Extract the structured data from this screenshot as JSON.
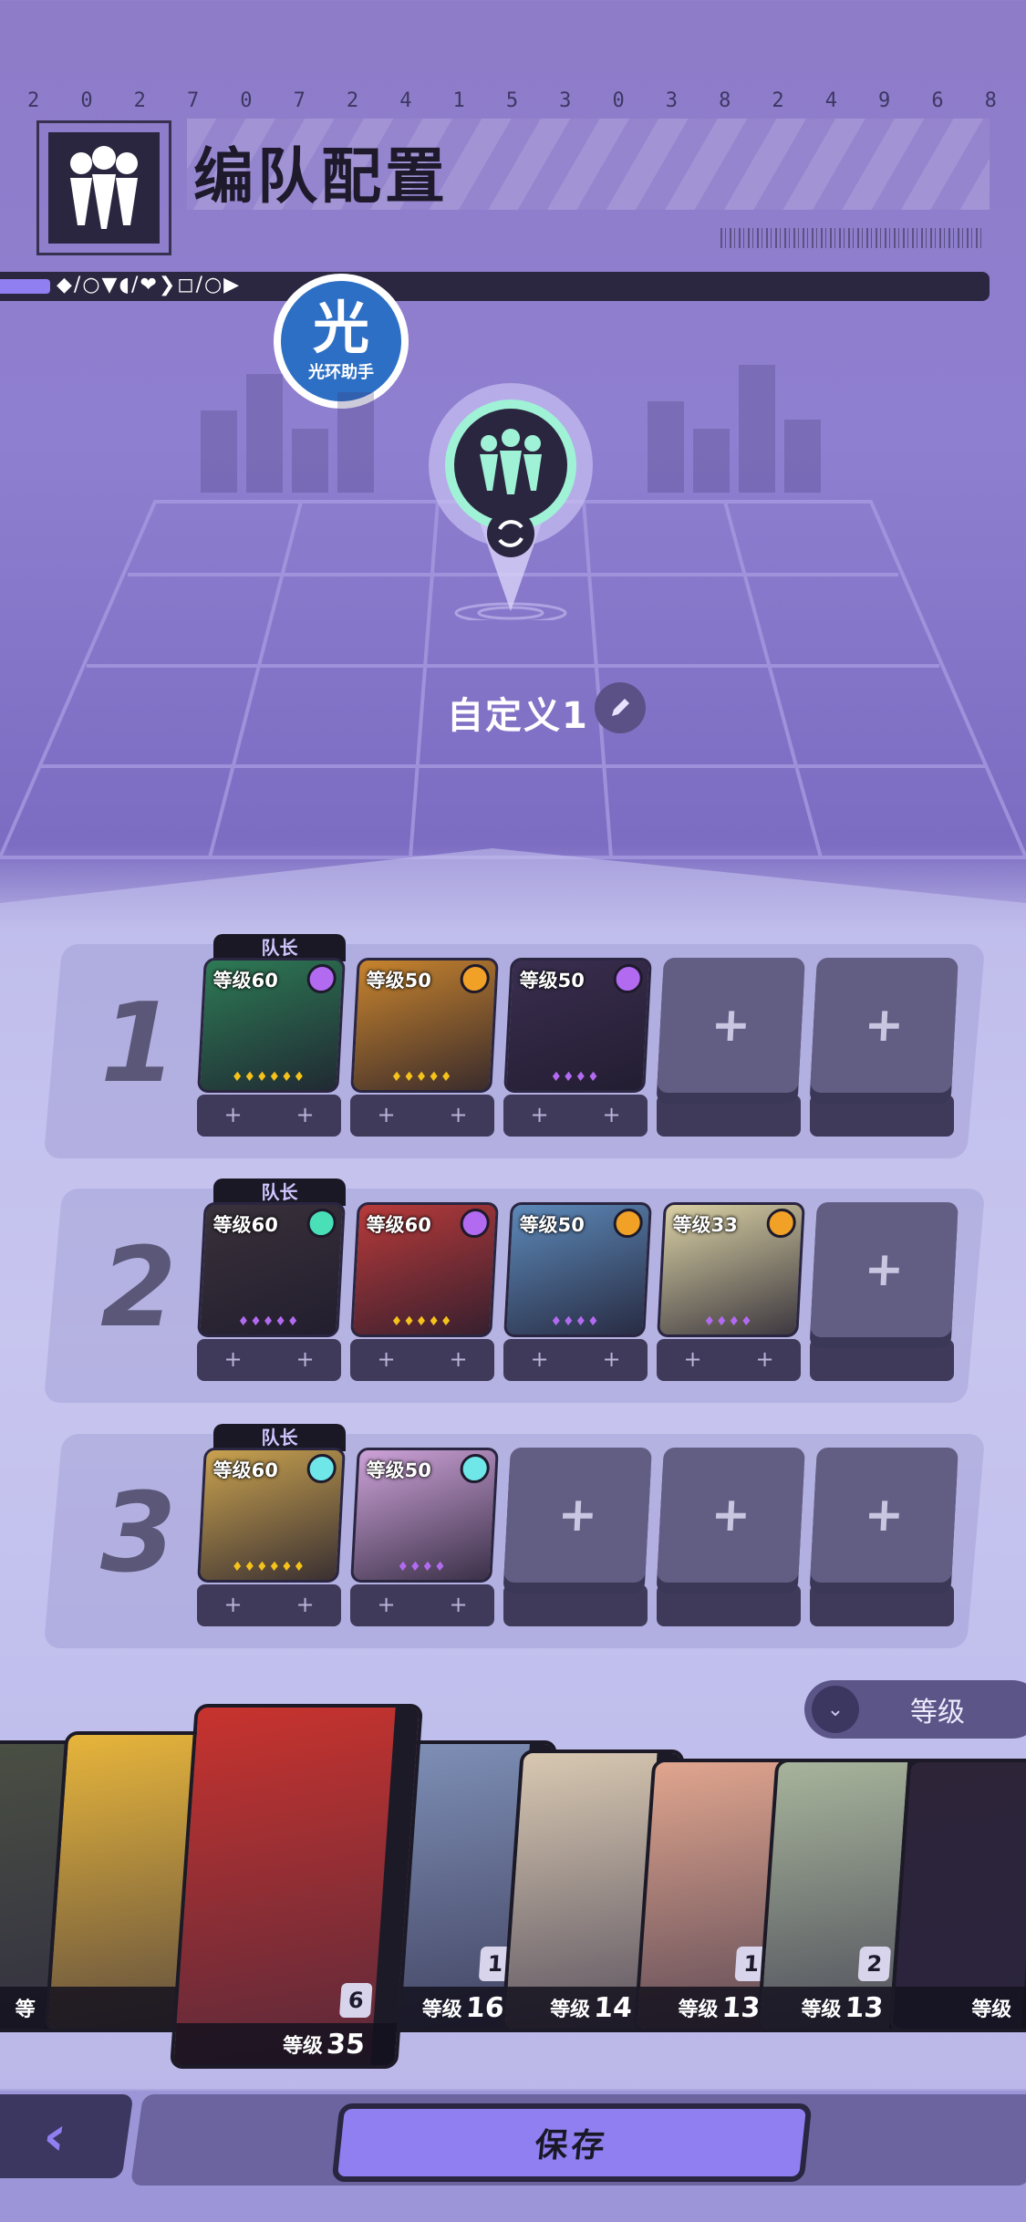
{
  "header": {
    "digits": [
      "2",
      "0",
      "2",
      "7",
      "0",
      "7",
      "2",
      "4",
      "1",
      "5",
      "3",
      "0",
      "3",
      "8",
      "2",
      "4",
      "9",
      "6",
      "8"
    ],
    "title": "编队配置",
    "status_glyphs": "◆/○▼◖/❤❯◻/○▶"
  },
  "watermark": {
    "big": "光",
    "small": "光环助手"
  },
  "team": {
    "name": "自定义1"
  },
  "squads": [
    {
      "number": "1",
      "members": [
        {
          "captain": "队长",
          "level": "等级60",
          "badge": "purple-psychic",
          "stars": "♦♦♦♦♦♦",
          "star_color": "#f4c21b",
          "art": "#2d7a55"
        },
        {
          "captain": "",
          "level": "等级50",
          "badge": "orange-gear",
          "stars": "♦♦♦♦♦",
          "star_color": "#f4c21b",
          "art": "#c8842d"
        },
        {
          "captain": "",
          "level": "等级50",
          "badge": "purple-psychic",
          "stars": "♦♦♦♦",
          "star_color": "#b26bf0",
          "art": "#3a2e4f"
        },
        {
          "empty": true,
          "plus": "+"
        },
        {
          "empty": true,
          "plus": "+"
        }
      ]
    },
    {
      "number": "2",
      "members": [
        {
          "captain": "队长",
          "level": "等级60",
          "badge": "teal-spiral",
          "stars": "♦♦♦♦♦",
          "star_color": "#b26bf0",
          "art": "#39313a"
        },
        {
          "captain": "",
          "level": "等级60",
          "badge": "purple-psychic",
          "stars": "♦♦♦♦♦",
          "star_color": "#f4c21b",
          "art": "#b73a3a"
        },
        {
          "captain": "",
          "level": "等级50",
          "badge": "orange-gear",
          "stars": "♦♦♦♦",
          "star_color": "#b26bf0",
          "art": "#5c88b8"
        },
        {
          "captain": "",
          "level": "等级33",
          "badge": "orange-gear",
          "stars": "♦♦♦♦",
          "star_color": "#b26bf0",
          "art": "#d9d0a3"
        },
        {
          "empty": true,
          "plus": "+"
        }
      ]
    },
    {
      "number": "3",
      "members": [
        {
          "captain": "队长",
          "level": "等级60",
          "badge": "teal-cross",
          "stars": "♦♦♦♦♦♦",
          "star_color": "#f4c21b",
          "art": "#c9a24f"
        },
        {
          "captain": "",
          "level": "等级50",
          "badge": "teal-cross",
          "stars": "♦♦♦♦",
          "star_color": "#b26bf0",
          "art": "#cda2d8"
        },
        {
          "empty": true,
          "plus": "+"
        },
        {
          "empty": true,
          "plus": "+"
        },
        {
          "empty": true,
          "plus": "+"
        }
      ]
    }
  ],
  "sort": {
    "label": "等级"
  },
  "roster": [
    {
      "prefix": "等",
      "level": "",
      "rank": "",
      "art": "#4a4f43"
    },
    {
      "prefix": "",
      "level": "",
      "rank": "",
      "art": "#e7b53b"
    },
    {
      "prefix": "等级",
      "level": "35",
      "rank": "6",
      "art": "#c8332e"
    },
    {
      "prefix": "等级",
      "level": "16",
      "rank": "1",
      "art": "#7e8fb6"
    },
    {
      "prefix": "等级",
      "level": "14",
      "rank": "",
      "art": "#d8c8b1"
    },
    {
      "prefix": "等级",
      "level": "13",
      "rank": "1",
      "art": "#e0a58e"
    },
    {
      "prefix": "等级",
      "level": "13",
      "rank": "2",
      "art": "#a7b49b"
    },
    {
      "prefix": "等级",
      "level": "",
      "rank": "",
      "art": "#2d2438"
    }
  ],
  "footer": {
    "back": "‹",
    "save": "保存"
  },
  "colors": {
    "accent": "#8f7ff0",
    "gold_star": "#f4c21b",
    "purple_star": "#b26bf0",
    "panel_dark": "#2a2540"
  }
}
